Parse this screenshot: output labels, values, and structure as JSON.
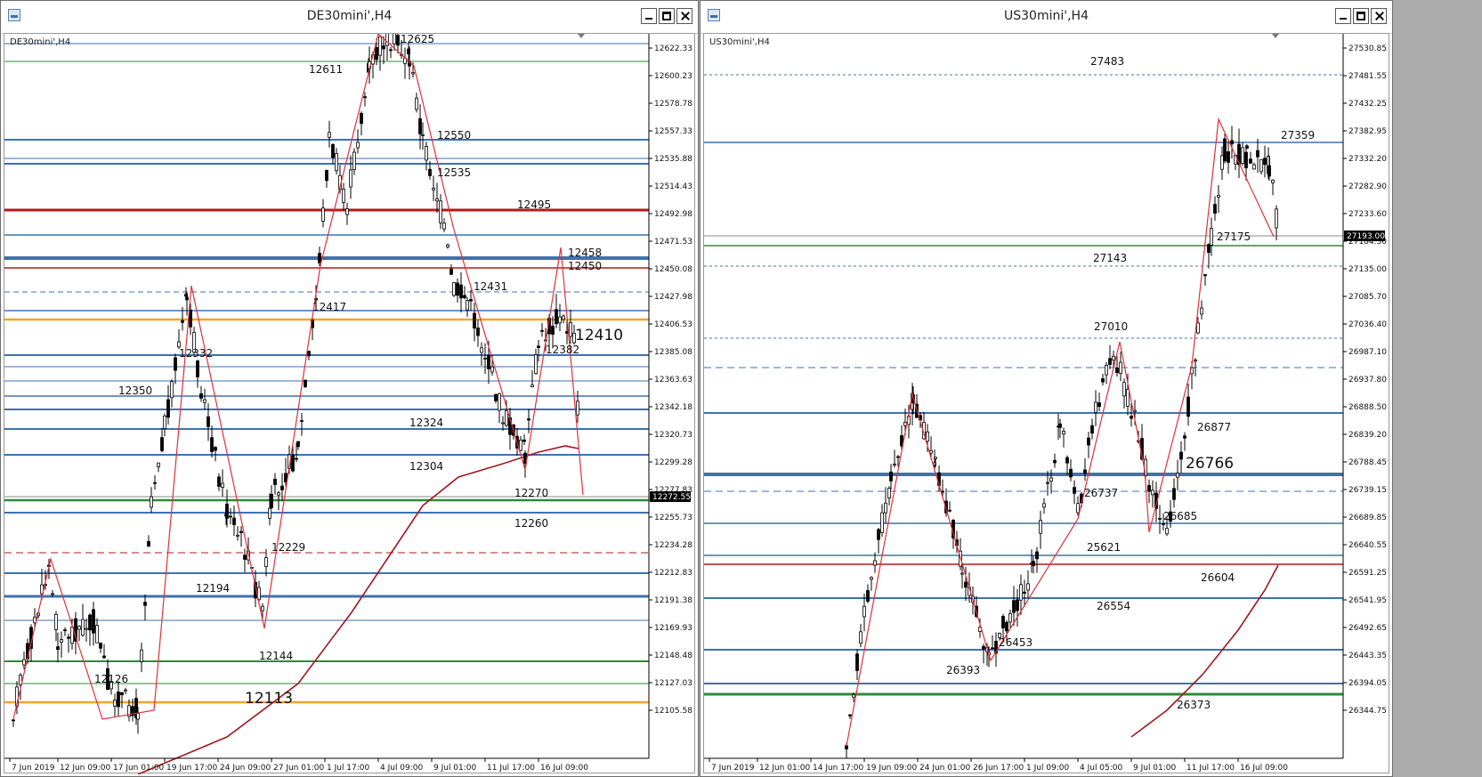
{
  "windows": [
    {
      "id": "de30",
      "title": "DE30mini',H4",
      "symbol_label": "DE30mini',H4",
      "price_axis": [
        "12622.33",
        "12600.23",
        "12578.78",
        "12557.33",
        "12535.88",
        "12514.43",
        "12492.98",
        "12471.53",
        "12450.08",
        "12427.98",
        "12406.53",
        "12385.08",
        "12363.63",
        "12342.18",
        "12320.73",
        "12299.28",
        "12277.83",
        "12255.73",
        "12234.28",
        "12212.83",
        "12191.38",
        "12169.93",
        "12148.48",
        "12127.03",
        "12105.58"
      ],
      "current_price": "12272.55",
      "time_axis": [
        "7 Jun 2019",
        "12 Jun 09:00",
        "17 Jun 01:00",
        "19 Jun 17:00",
        "24 Jun 09:00",
        "27 Jun 01:00",
        "1 Jul 17:00",
        "4 Jul 09:00",
        "9 Jul 01:00",
        "11 Jul 17:00",
        "16 Jul 09:00"
      ],
      "levels": [
        "12625",
        "12611",
        "12550",
        "12535",
        "12495",
        "12458",
        "12450",
        "12431",
        "12417",
        "12410",
        "12382",
        "12350",
        "12332",
        "12324",
        "12304",
        "12270",
        "12260",
        "12229",
        "12194",
        "12144",
        "12126",
        "12113"
      ]
    },
    {
      "id": "us30",
      "title": "US30mini',H4",
      "symbol_label": "US30mini',H4",
      "price_axis": [
        "27530.85",
        "27481.55",
        "27432.25",
        "27382.95",
        "27332.20",
        "27282.90",
        "27233.60",
        "27184.30",
        "27135.00",
        "27085.70",
        "27036.40",
        "26987.10",
        "26937.80",
        "26888.50",
        "26839.20",
        "26788.45",
        "26739.15",
        "26689.85",
        "26640.55",
        "26591.25",
        "26541.95",
        "26492.65",
        "26443.35",
        "26394.05",
        "26344.75"
      ],
      "current_price": "27193.00",
      "time_axis": [
        "7 Jun 2019",
        "12 Jun 01:00",
        "14 Jun 17:00",
        "19 Jun 09:00",
        "24 Jun 01:00",
        "26 Jun 17:00",
        "1 Jul 09:00",
        "4 Jul 05:00",
        "9 Jul 01:00",
        "11 Jul 17:00",
        "16 Jul 09:00"
      ],
      "levels": [
        "27483",
        "27359",
        "27175",
        "27143",
        "27010",
        "26877",
        "26766",
        "26737",
        "26685",
        "25621",
        "26604",
        "26554",
        "26453",
        "26393",
        "26373"
      ]
    }
  ],
  "colors": {
    "blue_level": "#3d72b0",
    "red_level": "#b01a1a",
    "orange_level": "#f5a32a",
    "green_level": "#2e8b3a",
    "zigzag": "#e0303a",
    "ma": "#a0161e"
  }
}
